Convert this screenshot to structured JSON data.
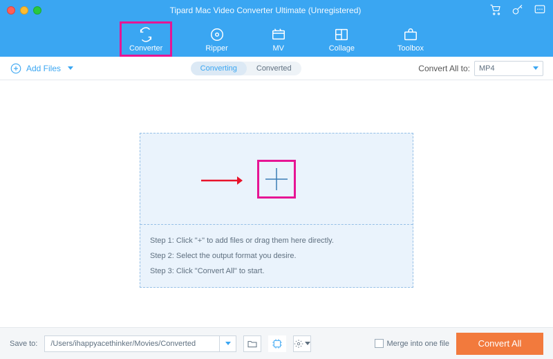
{
  "window": {
    "title": "Tipard Mac Video Converter Ultimate (Unregistered)"
  },
  "nav": {
    "converter": "Converter",
    "ripper": "Ripper",
    "mv": "MV",
    "collage": "Collage",
    "toolbox": "Toolbox"
  },
  "subbar": {
    "addFiles": "Add Files",
    "converting": "Converting",
    "converted": "Converted",
    "convertAllTo": "Convert All to:",
    "format": "MP4"
  },
  "steps": {
    "s1": "Step 1: Click \"+\" to add files or drag them here directly.",
    "s2": "Step 2: Select the output format you desire.",
    "s3": "Step 3: Click \"Convert All\" to start."
  },
  "footer": {
    "saveTo": "Save to:",
    "path": "/Users/ihappyacethinker/Movies/Converted",
    "merge": "Merge into one file",
    "convertAll": "Convert All"
  }
}
